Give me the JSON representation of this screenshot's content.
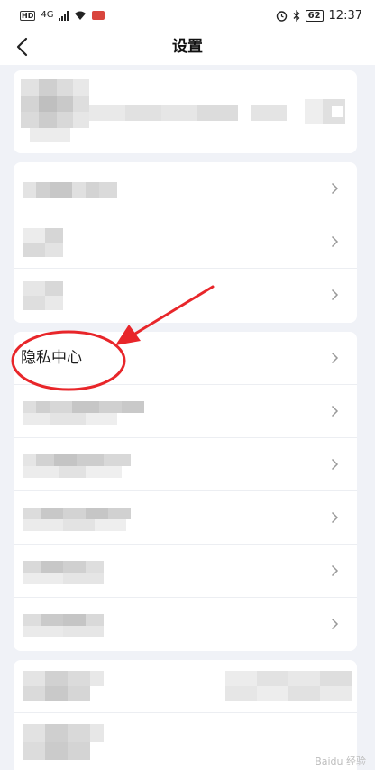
{
  "status_bar": {
    "network": "4G",
    "hd_badge": "HD",
    "battery": "62",
    "time": "12:37"
  },
  "header": {
    "title": "设置",
    "back_icon": "chevron-left-icon"
  },
  "privacy_item": {
    "label": "隐私中心"
  },
  "colors": {
    "annotation": "#e8262a",
    "background": "#f0f2f7"
  },
  "watermark": {
    "text": "Baidu 经验"
  }
}
